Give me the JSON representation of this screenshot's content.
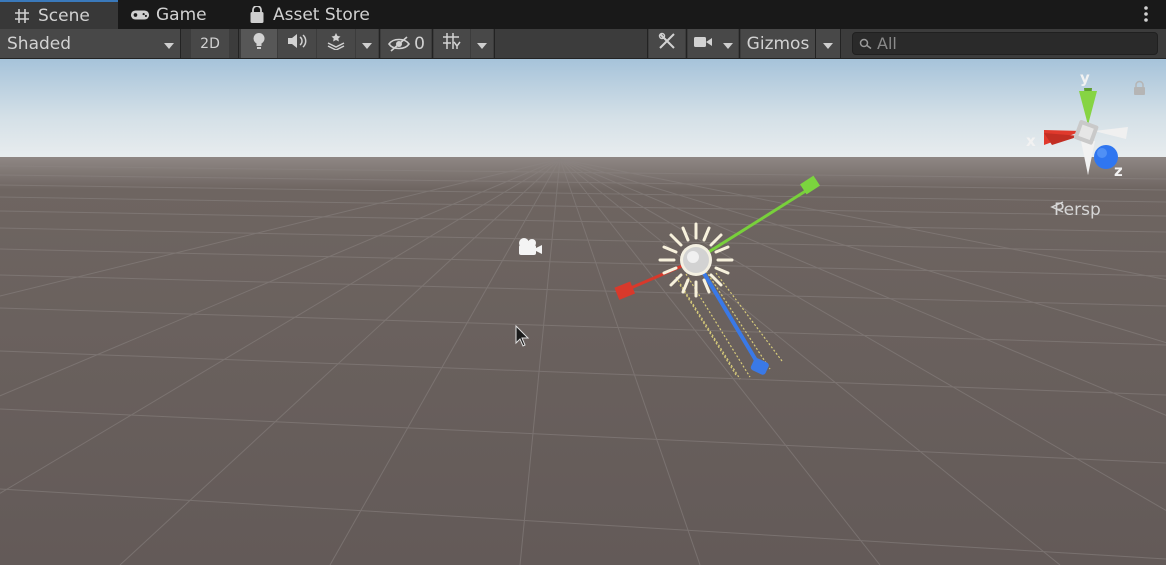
{
  "tabs": {
    "scene": "Scene",
    "game": "Game",
    "asset_store": "Asset Store"
  },
  "toolbar": {
    "draw_mode": "Shaded",
    "mode_2d": "2D",
    "hidden_count": "0",
    "gizmos": "Gizmos",
    "search_placeholder": "All"
  },
  "gizmo": {
    "x_label": "x",
    "y_label": "y",
    "z_label": "z",
    "projection": "Persp"
  },
  "colors": {
    "tab_bar": "#191919",
    "toolbar": "#3c3c3c",
    "active_tab_accent": "#3a79bb",
    "ground": "#6e6360",
    "x_axis": "#d8392b",
    "y_axis": "#78d03b",
    "z_axis": "#3a79e6"
  }
}
